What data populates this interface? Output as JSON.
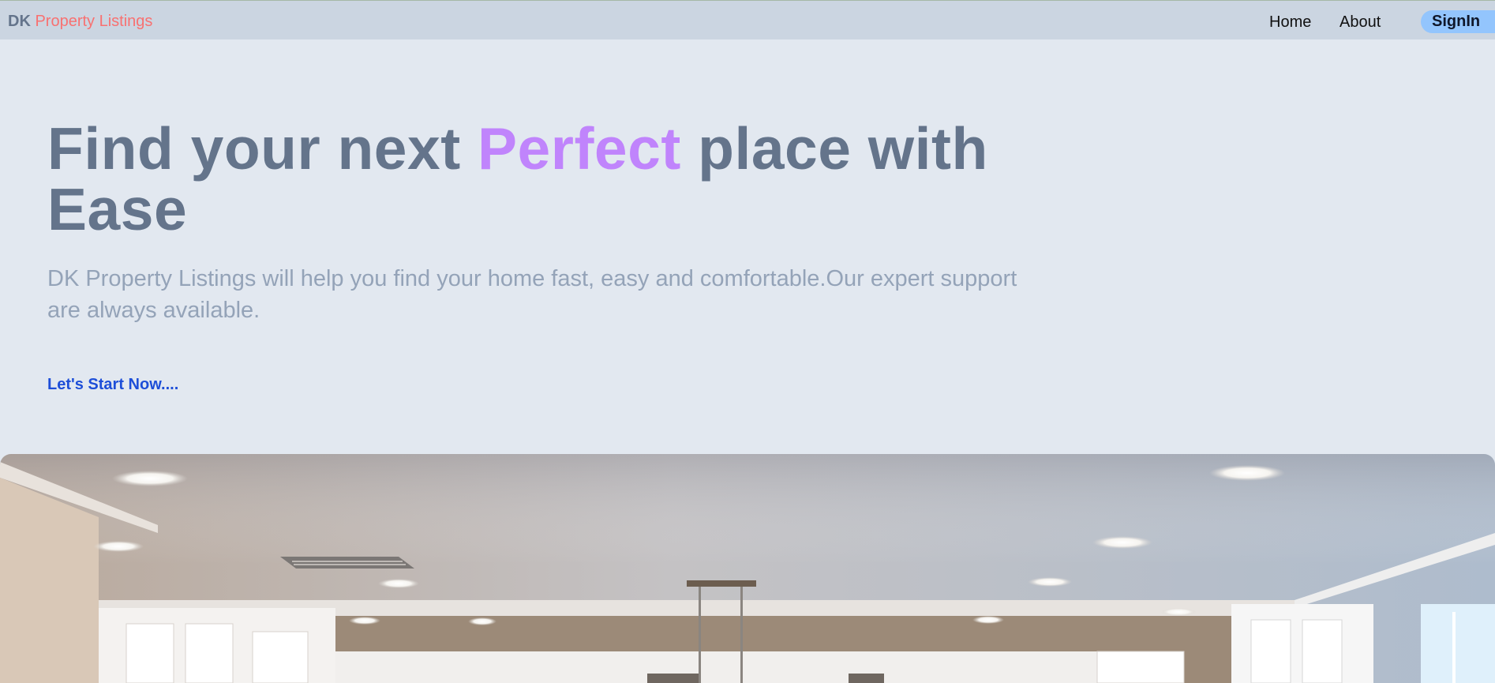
{
  "brand": {
    "prefix": "DK",
    "name": "Property Listings"
  },
  "nav": {
    "home": "Home",
    "about": "About",
    "signin": "SignIn"
  },
  "hero": {
    "title_before": "Find your next ",
    "title_accent": "Perfect",
    "title_after": " place with Ease",
    "subtitle": "DK Property Listings will help you find your home fast, easy and comfortable.Our expert support are always available.",
    "cta": "Let's Start Now....",
    "image": "kitchen interior photo with recessed ceiling lights and white cabinets"
  },
  "colors": {
    "page_bg": "#e2e8f0",
    "header_bg": "#cbd5e1",
    "brand_prefix": "#64748b",
    "brand_name": "#f87171",
    "title": "#64748b",
    "title_accent": "#c084fc",
    "subtitle": "#94a3b8",
    "cta": "#1d4ed8",
    "signin_bg": "#93c5fd"
  }
}
